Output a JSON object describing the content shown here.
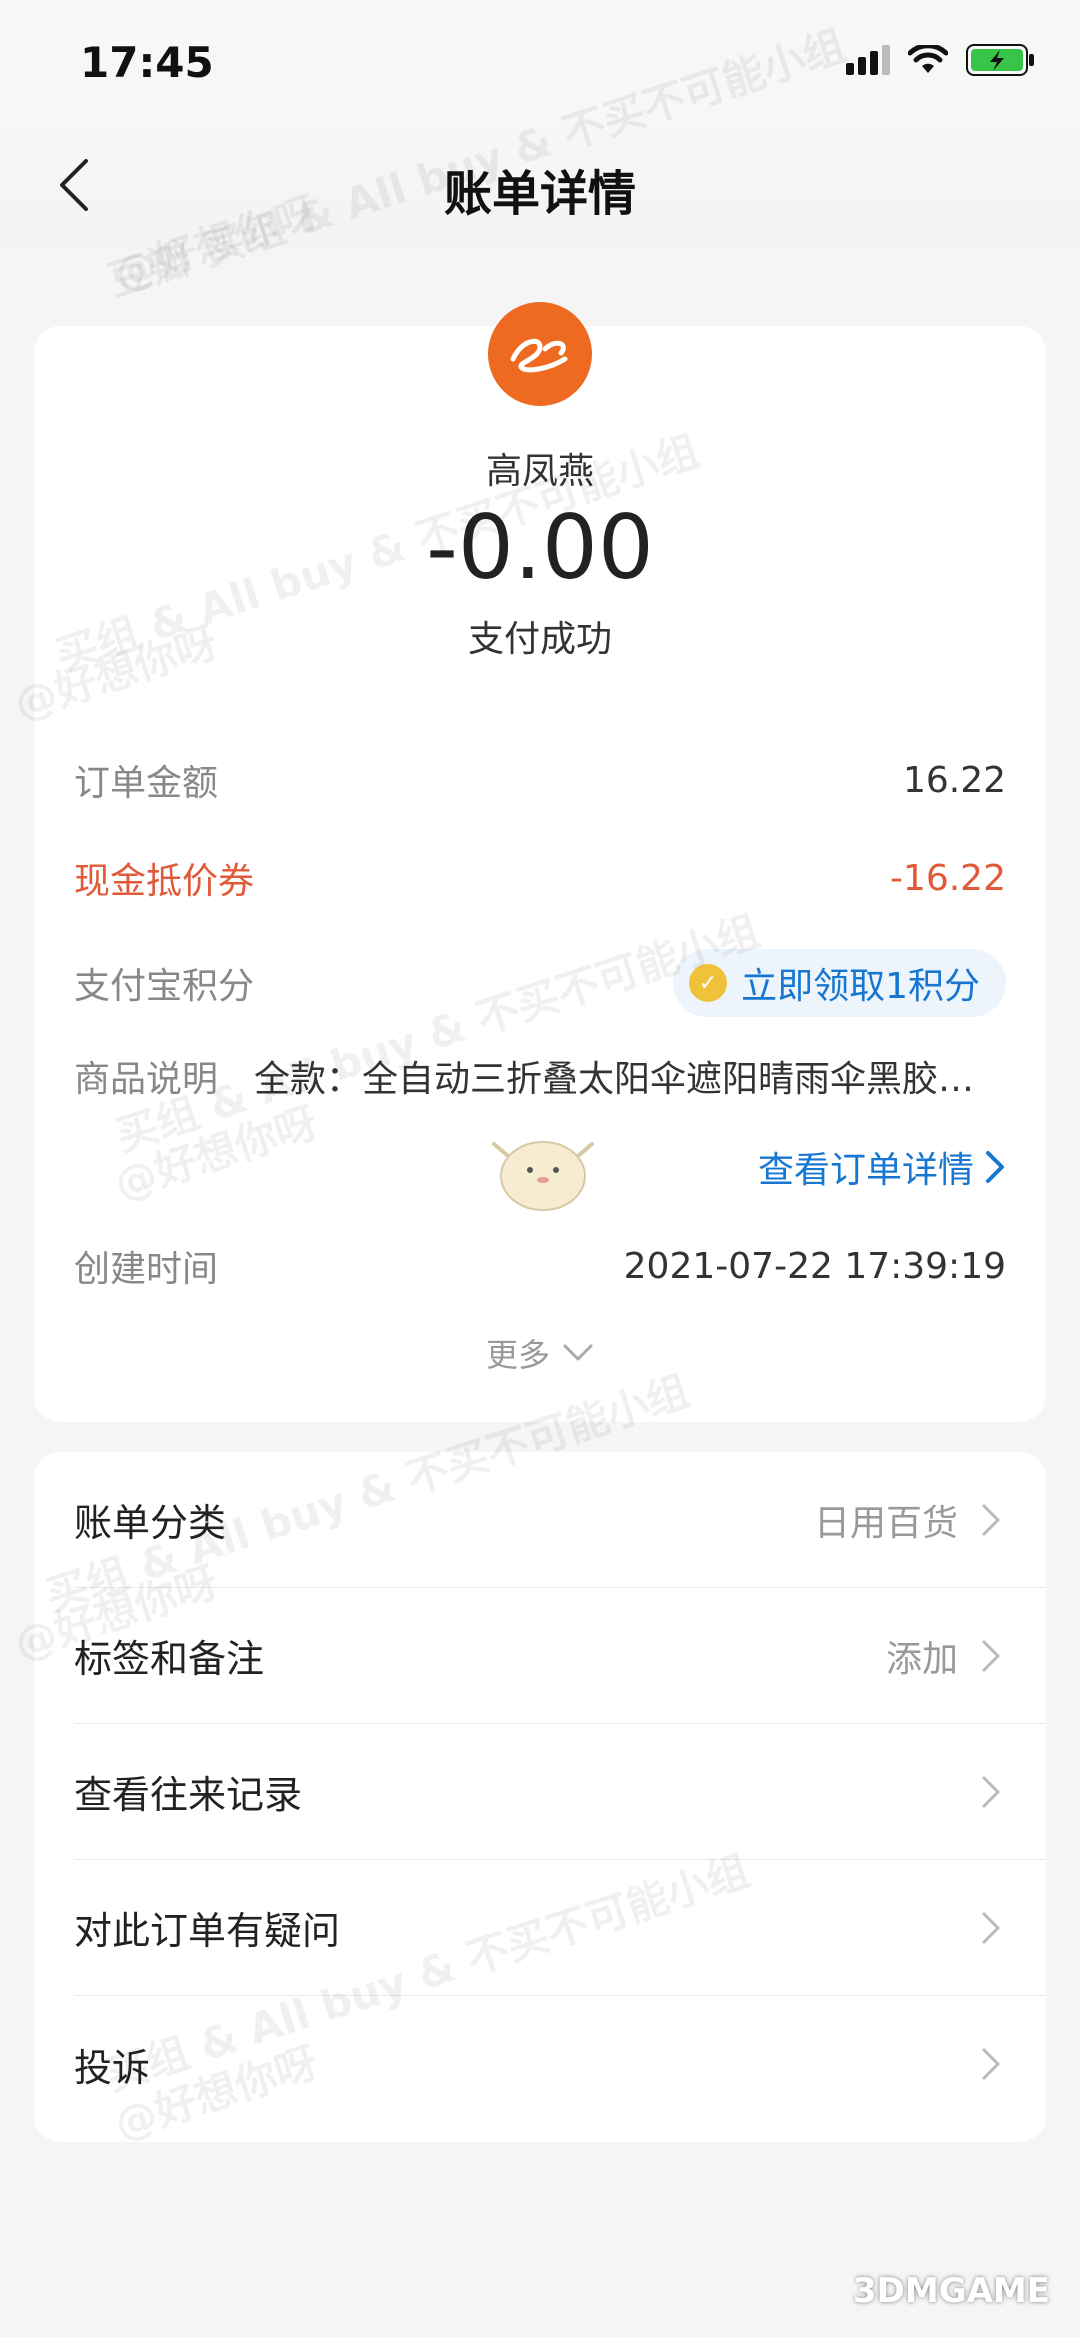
{
  "status_bar": {
    "time": "17:45"
  },
  "nav": {
    "title": "账单详情"
  },
  "merchant": {
    "name": "高凤燕",
    "amount": "-0.00",
    "status": "支付成功"
  },
  "details": {
    "order_amount": {
      "label": "订单金额",
      "value": "16.22"
    },
    "coupon": {
      "label": "现金抵价券",
      "value": "-16.22"
    },
    "points": {
      "label": "支付宝积分",
      "action": "立即领取1积分"
    },
    "description": {
      "label": "商品说明",
      "value": "全款：全自动三折叠太阳伞遮阳晴雨伞黑胶防晒防紫外线"
    },
    "order_link": "查看订单详情",
    "created": {
      "label": "创建时间",
      "value": "2021-07-22 17:39:19"
    },
    "more": "更多"
  },
  "menu": [
    {
      "label": "账单分类",
      "value": "日用百货"
    },
    {
      "label": "标签和备注",
      "value": "添加"
    },
    {
      "label": "查看往来记录",
      "value": ""
    },
    {
      "label": "对此订单有疑问",
      "value": ""
    },
    {
      "label": "投诉",
      "value": ""
    }
  ],
  "watermark": {
    "group": "买组 & All buy & 不买不可能小组",
    "user": "@好想你呀",
    "tag": "豆瓣"
  },
  "corner_logo": "3DMGAME",
  "colors": {
    "accent_blue": "#1677d2",
    "warning_red": "#e05a3a",
    "logo_orange": "#ee6a20"
  }
}
